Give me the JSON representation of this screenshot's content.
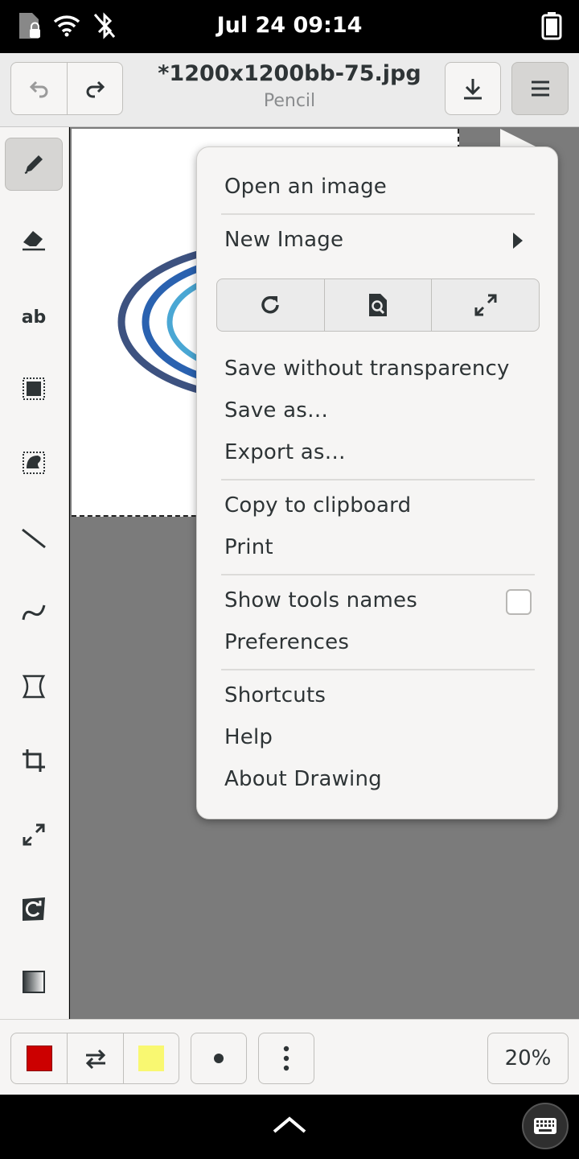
{
  "status_bar": {
    "datetime": "Jul 24  09:14",
    "icons": [
      "sim-locked-icon",
      "wifi-icon",
      "bluetooth-off-icon",
      "battery-icon"
    ]
  },
  "header": {
    "title": "*1200x1200bb-75.jpg",
    "subtitle": "Pencil",
    "buttons": [
      "undo-icon",
      "redo-icon",
      "download-icon",
      "menu-icon"
    ]
  },
  "tools": [
    {
      "name": "pencil",
      "icon": "pencil-icon",
      "active": true
    },
    {
      "name": "eraser",
      "icon": "eraser-icon"
    },
    {
      "name": "text",
      "icon": "text-icon",
      "label": "ab"
    },
    {
      "name": "rect-selection",
      "icon": "rect-selection-icon"
    },
    {
      "name": "free-selection",
      "icon": "free-selection-icon"
    },
    {
      "name": "line",
      "icon": "line-icon"
    },
    {
      "name": "curve",
      "icon": "curve-icon"
    },
    {
      "name": "shape",
      "icon": "shape-icon"
    },
    {
      "name": "crop",
      "icon": "crop-icon"
    },
    {
      "name": "scale",
      "icon": "scale-icon"
    },
    {
      "name": "rotate",
      "icon": "rotate-icon"
    },
    {
      "name": "filters",
      "icon": "filters-icon"
    }
  ],
  "menu": {
    "open_image": "Open an image",
    "new_image": "New Image",
    "action_buttons": [
      "reload-icon",
      "properties-icon",
      "fullscreen-icon"
    ],
    "save_without_transparency": "Save without transparency",
    "save_as": "Save as…",
    "export_as": "Export as…",
    "copy_clipboard": "Copy to clipboard",
    "print": "Print",
    "show_tool_names": "Show tools names",
    "show_tool_names_checked": false,
    "preferences": "Preferences",
    "shortcuts": "Shortcuts",
    "help": "Help",
    "about": "About Drawing"
  },
  "bottom_bar": {
    "main_color": "#cc0000",
    "secondary_color": "#f9f871",
    "zoom": "20%"
  },
  "image_colors": {
    "ring_outer": "#3d5280",
    "ring_middle": "#2a62b0",
    "ring_inner": "#4aa7d4"
  }
}
